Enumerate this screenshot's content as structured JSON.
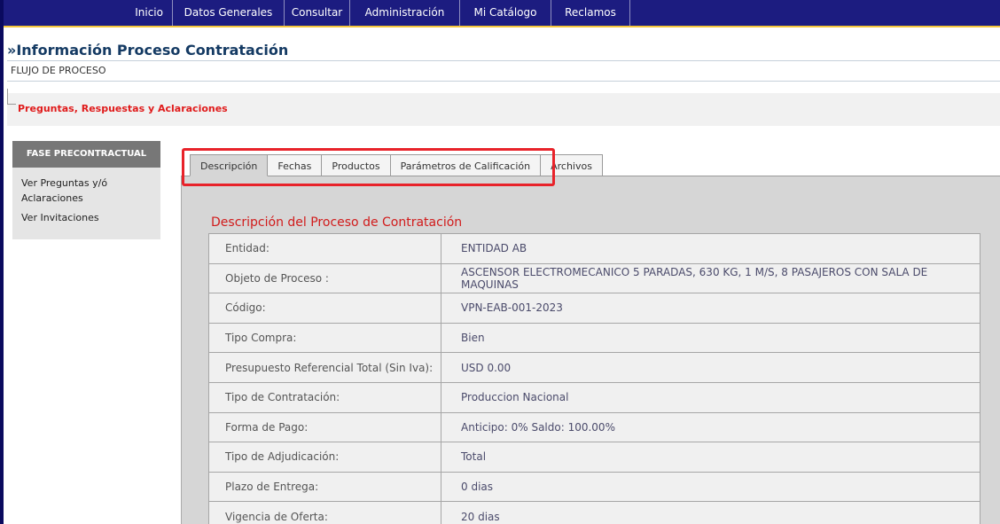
{
  "nav": {
    "items": [
      "Inicio",
      "Datos Generales",
      "Consultar",
      "Administración",
      "Mi Catálogo",
      "Reclamos"
    ]
  },
  "page": {
    "title": "»Información Proceso Contratación",
    "flujo": "FLUJO DE PROCESO",
    "preguntas_link": "Preguntas, Respuestas y Aclaraciones"
  },
  "sidebar": {
    "header": "FASE PRECONTRACTUAL",
    "items": [
      "Ver Preguntas y/ó Aclaraciones",
      "Ver Invitaciones"
    ]
  },
  "tabs": [
    "Descripción",
    "Fechas",
    "Productos",
    "Parámetros de Calificación",
    "Archivos"
  ],
  "active_tab": "Descripción",
  "description": {
    "title": "Descripción del Proceso de Contratación",
    "rows": [
      {
        "label": "Entidad:",
        "value": "ENTIDAD AB"
      },
      {
        "label": "Objeto de Proceso :",
        "value": "ASCENSOR ELECTROMECANICO 5 PARADAS, 630 KG, 1 M/S, 8 PASAJEROS CON SALA DE MAQUINAS"
      },
      {
        "label": "Código:",
        "value": "VPN-EAB-001-2023"
      },
      {
        "label": "Tipo Compra:",
        "value": "Bien"
      },
      {
        "label": "Presupuesto Referencial Total (Sin Iva):",
        "value": "USD 0.00"
      },
      {
        "label": "Tipo de Contratación:",
        "value": "Produccion Nacional"
      },
      {
        "label": "Forma de Pago:",
        "value": "Anticipo: 0% Saldo: 100.00%"
      },
      {
        "label": "Tipo de Adjudicación:",
        "value": "Total"
      },
      {
        "label": "Plazo de Entrega:",
        "value": "0 dias"
      },
      {
        "label": "Vigencia de Oferta:",
        "value": "20 dias"
      }
    ]
  },
  "colors": {
    "nav_bg": "#1c1c80",
    "nav_accent": "#f4c63b",
    "title": "#143a63",
    "red_link": "#e01b1b",
    "highlight_box": "#e8232a"
  }
}
